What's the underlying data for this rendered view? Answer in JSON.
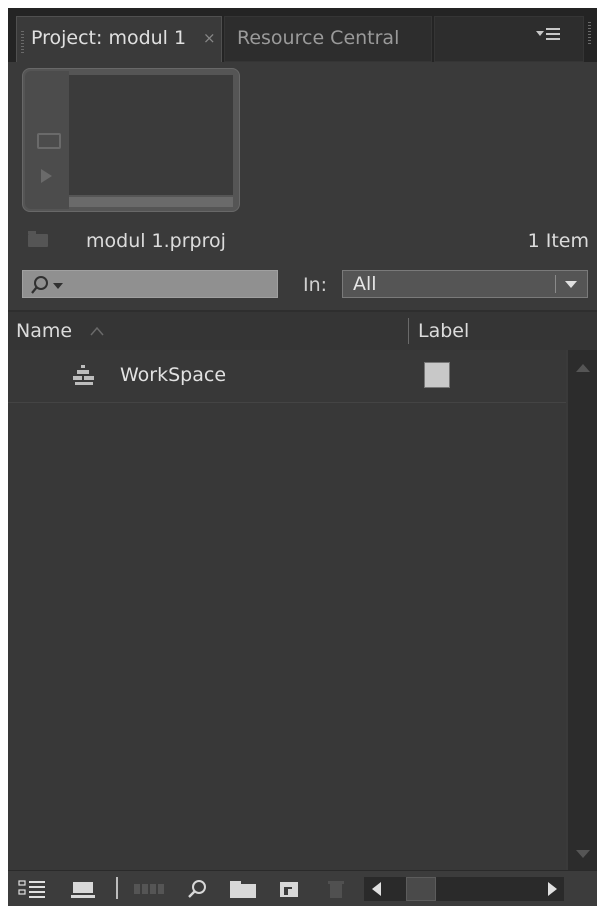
{
  "tabs": [
    {
      "label": "Project: modul 1",
      "active": true,
      "close_glyph": "×"
    },
    {
      "label": "Resource Central",
      "active": false
    }
  ],
  "project": {
    "file_name": "modul 1.prproj",
    "item_count": "1 Item"
  },
  "search": {
    "value": "",
    "in_label": "In:",
    "in_selected": "All"
  },
  "columns": {
    "name": "Name",
    "label": "Label"
  },
  "items": [
    {
      "name": "WorkSpace",
      "type": "sequence-icon",
      "label_color": "#c8c8c8"
    }
  ],
  "toolbar": {
    "icons": [
      "list-view-icon",
      "icon-view-icon",
      "automate-to-sequence-icon",
      "find-icon",
      "new-bin-icon",
      "new-item-icon",
      "clear-icon"
    ]
  },
  "colors": {
    "panel_bg": "#3a3a3a",
    "tabbar_bg": "#242424",
    "text": "#dcdcdc"
  }
}
